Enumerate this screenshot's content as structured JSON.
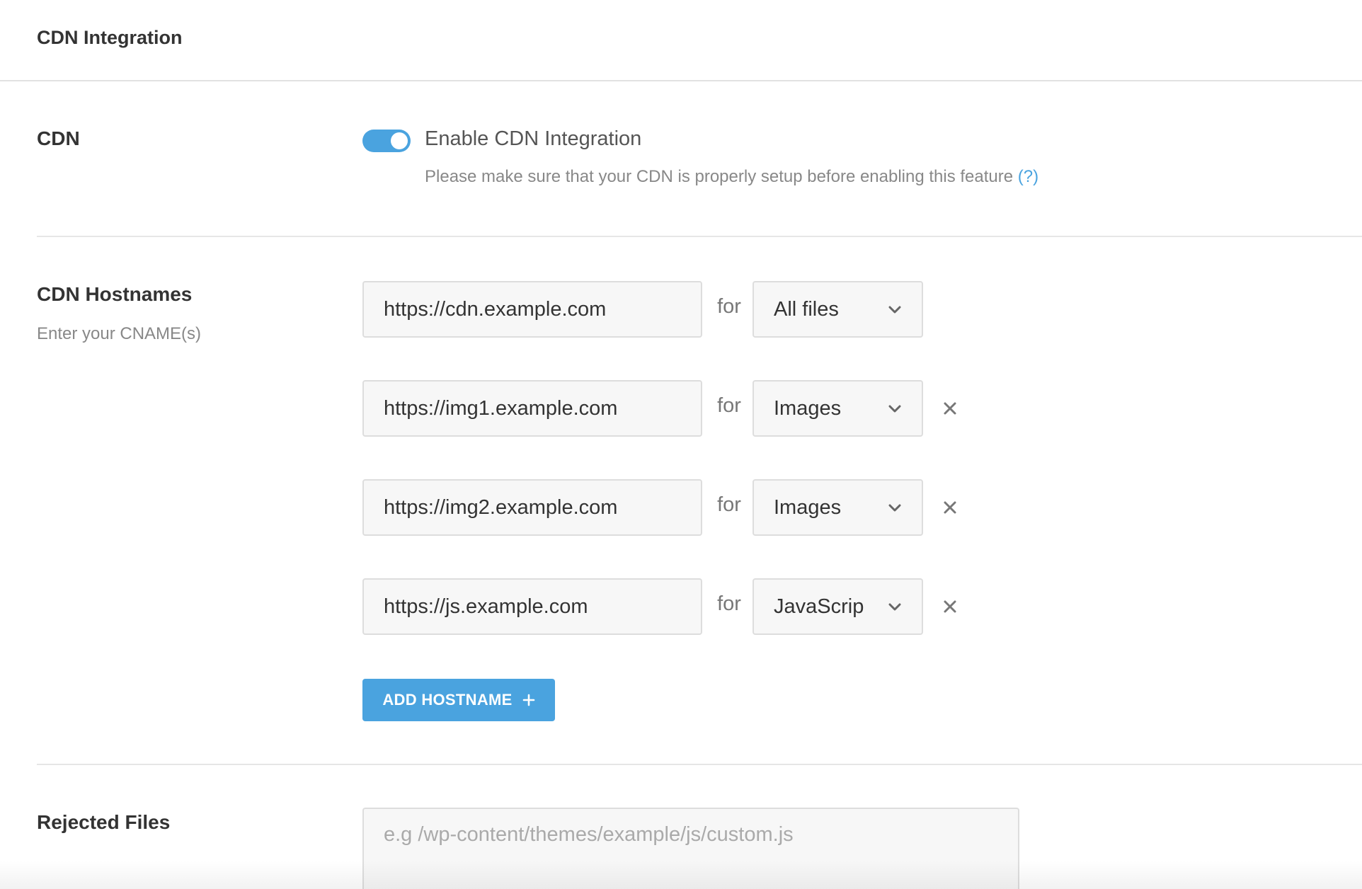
{
  "header": {
    "title": "CDN Integration"
  },
  "cdn": {
    "label": "CDN",
    "toggle_enabled": true,
    "toggle_label": "Enable CDN Integration",
    "description": "Please make sure that your CDN is properly setup before enabling this feature",
    "help_link": "(?)"
  },
  "hostnames": {
    "label": "CDN Hostnames",
    "sublabel": "Enter your CNAME(s)",
    "for_label": "for",
    "rows": [
      {
        "url": "https://cdn.example.com",
        "type": "All files",
        "removable": false
      },
      {
        "url": "https://img1.example.com",
        "type": "Images",
        "removable": true
      },
      {
        "url": "https://img2.example.com",
        "type": "Images",
        "removable": true
      },
      {
        "url": "https://js.example.com",
        "type": "JavaScrip",
        "removable": true
      }
    ],
    "add_button": "ADD HOSTNAME"
  },
  "rejected": {
    "label": "Rejected Files",
    "placeholder": "e.g /wp-content/themes/example/js/custom.js"
  },
  "colors": {
    "accent": "#4aa3df",
    "text": "#333333",
    "muted": "#888888",
    "border": "#dddddd",
    "field_bg": "#f7f7f7"
  },
  "icons": {
    "select_arrow": "chevron-down-icon",
    "remove": "close-icon",
    "add": "plus-icon"
  }
}
